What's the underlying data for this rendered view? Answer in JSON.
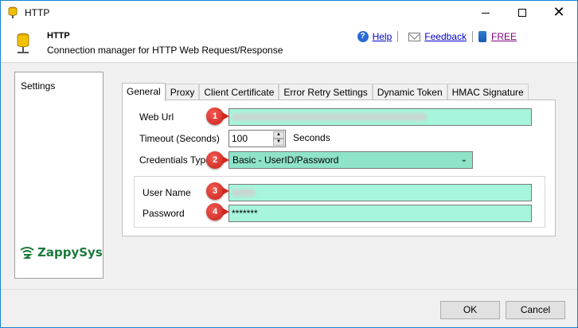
{
  "window": {
    "title": "HTTP"
  },
  "header": {
    "title": "HTTP",
    "subtitle": "Connection manager for HTTP Web Request/Response",
    "links": {
      "help": "Help",
      "feedback": "Feedback",
      "free": "FREE"
    }
  },
  "sidebar": {
    "items": [
      {
        "label": "Settings"
      }
    ],
    "logo_text": "ZappySys"
  },
  "tabs": [
    {
      "label": "General",
      "active": true
    },
    {
      "label": "Proxy",
      "active": false
    },
    {
      "label": "Client Certificate",
      "active": false
    },
    {
      "label": "Error Retry Settings",
      "active": false
    },
    {
      "label": "Dynamic Token",
      "active": false
    },
    {
      "label": "HMAC Signature",
      "active": false
    }
  ],
  "form": {
    "web_url_label": "Web Url",
    "timeout_label": "Timeout (Seconds)",
    "timeout_value": "100",
    "timeout_unit": "Seconds",
    "credentials_label": "Credentials Type",
    "credentials_value": "Basic - UserID/Password",
    "username_label": "User Name",
    "password_label": "Password",
    "password_value": "*******"
  },
  "badges": [
    "1",
    "2",
    "3",
    "4"
  ],
  "footer": {
    "ok_label": "OK",
    "cancel_label": "Cancel"
  },
  "colors": {
    "field_bg": "#a6f5dc",
    "select_bg": "#8fe3c8",
    "badge": "#d0281f",
    "link": "#0000cc",
    "accent_border": "#1883d7"
  }
}
